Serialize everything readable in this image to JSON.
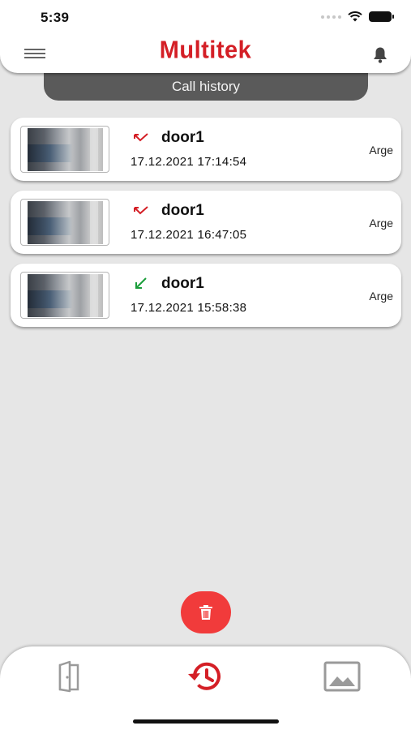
{
  "status_bar": {
    "time": "5:39"
  },
  "header": {
    "logo_text": "Multitek",
    "brand_color": "#d41f26",
    "menu_icon": "hamburger-icon",
    "notification_icon": "bell-icon"
  },
  "tab_title": "Call history",
  "calls": [
    {
      "door": "door1",
      "datetime": "17.12.2021 17:14:54",
      "group": "Arge",
      "type": "missed",
      "arrow_color": "#d41f26"
    },
    {
      "door": "door1",
      "datetime": "17.12.2021 16:47:05",
      "group": "Arge",
      "type": "missed",
      "arrow_color": "#d41f26"
    },
    {
      "door": "door1",
      "datetime": "17.12.2021 15:58:38",
      "group": "Arge",
      "type": "incoming",
      "arrow_color": "#1a9d3a"
    }
  ],
  "delete_button": {
    "icon": "trash-icon",
    "color": "#f13b3b"
  },
  "bottom_nav": [
    {
      "icon": "door-icon",
      "active": false
    },
    {
      "icon": "history-icon",
      "active": true
    },
    {
      "icon": "gallery-icon",
      "active": false
    }
  ]
}
